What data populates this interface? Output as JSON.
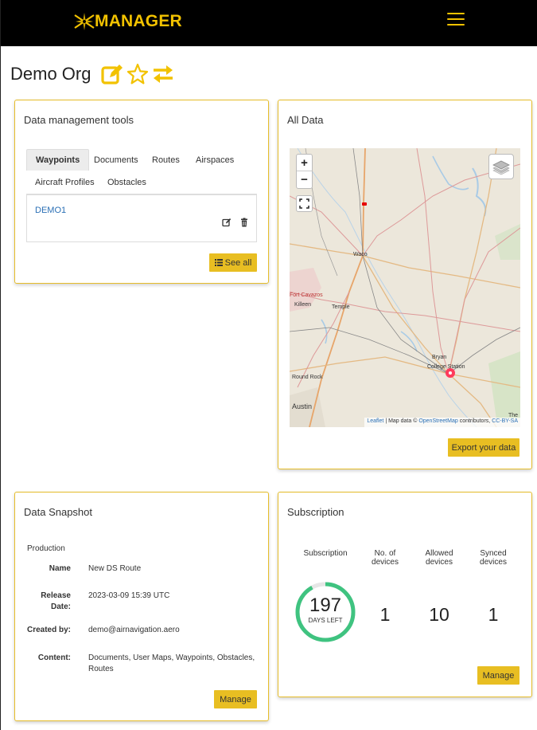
{
  "header": {
    "brand": "MANAGER",
    "colors": {
      "bar": "#000000",
      "accent": "#f2c200"
    }
  },
  "org": {
    "name": "Demo Org"
  },
  "tools": {
    "title": "Data management tools",
    "tabs": [
      "Waypoints",
      "Documents",
      "Routes",
      "Airspaces",
      "Aircraft Profiles",
      "Obstacles"
    ],
    "active_tab": "Waypoints",
    "items": [
      {
        "name": "DEMO1"
      }
    ],
    "see_all_label": "See all"
  },
  "alldata": {
    "title": "All Data",
    "map": {
      "zoom_in": "+",
      "zoom_out": "−",
      "attribution_leaflet": "Leaflet",
      "attribution_text": "| Map data ©",
      "attribution_osm": "OpenStreetMap",
      "attribution_contrib": "contributors,",
      "attribution_license": "CC-BY-SA",
      "labels": [
        "Waco",
        "Fort Cavazos",
        "Killeen",
        "Temple",
        "Bryan",
        "College Station",
        "Round Rock",
        "Austin",
        "The"
      ]
    },
    "export_label": "Export your data"
  },
  "snapshot": {
    "title": "Data Snapshot",
    "section": "Production",
    "name_key": "Name",
    "name_val": "New DS Route",
    "release_key_1": "Release",
    "release_key_2": "Date:",
    "release_val": "2023-03-09 15:39 UTC",
    "created_key": "Created by:",
    "created_val": "demo@airnavigation.aero",
    "content_key": "Content:",
    "content_val": "Documents, User Maps, Waypoints, Obstacles, Routes",
    "manage_label": "Manage"
  },
  "subscription": {
    "title": "Subscription",
    "headers": {
      "subscription": "Subscription",
      "devices_1": "No. of",
      "devices_2": "devices",
      "allowed_1": "Allowed",
      "allowed_2": "devices",
      "synced_1": "Synced",
      "synced_2": "devices"
    },
    "days_left": "197",
    "days_left_label": "DAYS LEFT",
    "days_fraction_remaining": 0.92,
    "no_of_devices": "1",
    "allowed_devices": "10",
    "synced_devices": "1",
    "manage_label": "Manage",
    "ring_color": "#3fc380"
  }
}
